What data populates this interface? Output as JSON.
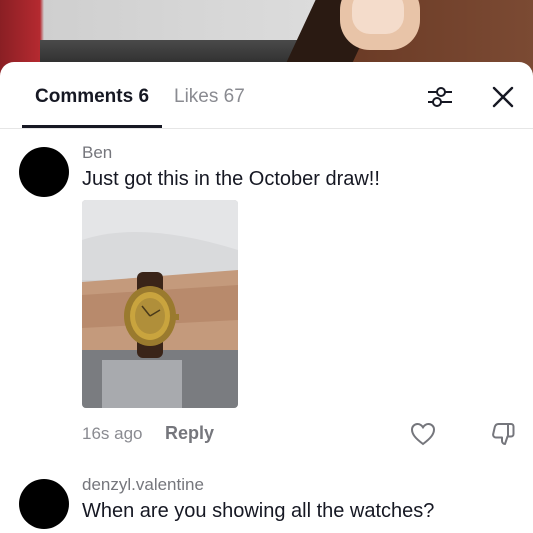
{
  "tabs": {
    "comments_label": "Comments 6",
    "likes_label": "Likes 67"
  },
  "icons": {
    "filter": "sliders-icon",
    "close": "close-icon",
    "like": "heart-icon",
    "dislike": "thumbs-down-icon"
  },
  "comments": [
    {
      "username": "Ben",
      "text": "Just got this in the October draw!!",
      "has_image": true,
      "time": "16s ago",
      "reply_label": "Reply"
    },
    {
      "username": "denzyl.valentine",
      "text": "When are you showing all the watches?"
    }
  ],
  "colors": {
    "primary_text": "#161823",
    "secondary_text": "#8a8b91",
    "divider": "#e6e6e6",
    "avatar": "#000000"
  }
}
